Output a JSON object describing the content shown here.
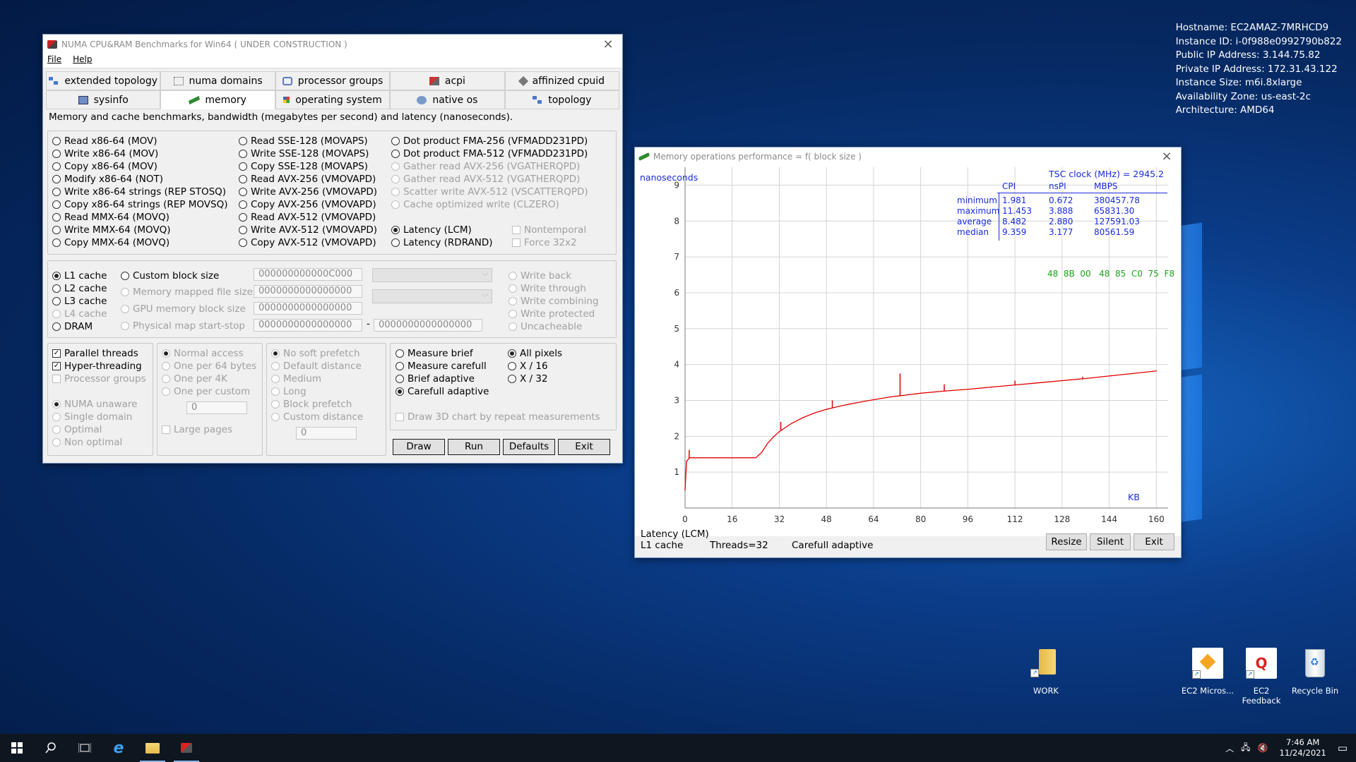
{
  "sysinfo": {
    "lines": [
      "Hostname: EC2AMAZ-7MRHCD9",
      "Instance ID: i-0f988e0992790b822",
      "Public IP Address: 3.144.75.82",
      "Private IP Address: 172.31.43.122",
      "Instance Size: m6i.8xlarge",
      "Availability Zone: us-east-2c",
      "Architecture: AMD64"
    ]
  },
  "main": {
    "title": "NUMA CPU&RAM Benchmarks for Win64 ( UNDER CONSTRUCTION )",
    "menu": [
      "File",
      "Help"
    ],
    "tabs_row1": [
      {
        "label": "extended topology",
        "icon": "topology-icon"
      },
      {
        "label": "numa domains",
        "icon": "numa-icon"
      },
      {
        "label": "processor groups",
        "icon": "groups-icon"
      },
      {
        "label": "acpi",
        "icon": "acpi-icon"
      },
      {
        "label": "affinized cpuid",
        "icon": "cpuid-icon"
      }
    ],
    "tabs_row2": [
      {
        "label": "sysinfo",
        "icon": "sysinfo-icon"
      },
      {
        "label": "memory",
        "icon": "memory-icon",
        "active": true
      },
      {
        "label": "operating system",
        "icon": "os-icon"
      },
      {
        "label": "native os",
        "icon": "native-icon"
      },
      {
        "label": "topology",
        "icon": "topology-icon"
      }
    ],
    "description": "Memory and cache benchmarks, bandwidth (megabytes per second) and latency (nanoseconds).",
    "ops_col1": [
      "Read x86-64 (MOV)",
      "Write x86-64 (MOV)",
      "Copy x86-64 (MOV)",
      "Modify x86-64 (NOT)",
      "Write x86-64 strings (REP STOSQ)",
      "Copy x86-64 strings (REP MOVSQ)",
      "Read MMX-64 (MOVQ)",
      "Write MMX-64 (MOVQ)",
      "Copy MMX-64 (MOVQ)"
    ],
    "ops_col2": [
      "Read SSE-128 (MOVAPS)",
      "Write SSE-128 (MOVAPS)",
      "Copy SSE-128 (MOVAPS)",
      "Read AVX-256 (VMOVAPD)",
      "Write AVX-256 (VMOVAPD)",
      "Copy AVX-256 (VMOVAPD)",
      "Read AVX-512 (VMOVAPD)",
      "Write AVX-512 (VMOVAPD)",
      "Copy AVX-512 (VMOVAPD)"
    ],
    "ops_col3": [
      "Dot product FMA-256 (VFMADD231PD)",
      "Dot product FMA-512 (VFMADD231PD)",
      "Gather read AVX-256 (VGATHERQPD)",
      "Gather read AVX-512 (VGATHERQPD)",
      "Scatter write AVX-512 (VSCATTERQPD)",
      "Cache optimized write (CLZERO)"
    ],
    "latency_lcm": "Latency (LCM)",
    "latency_rdrand": "Latency (RDRAND)",
    "nontemporal": "Nontemporal",
    "force32": "Force 32x2",
    "cache": [
      "L1 cache",
      "L2 cache",
      "L3 cache",
      "L4 cache",
      "DRAM"
    ],
    "custom_block": "Custom block size",
    "mmf": "Memory mapped file size",
    "gpu": "GPU memory block size",
    "phys": "Physical map start-stop",
    "tb_custom": "000000000000C000",
    "tb_mmf": "0000000000000000",
    "tb_gpu": "0000000000000000",
    "tb_phys1": "0000000000000000",
    "tb_phys2": "0000000000000000",
    "dash": "-",
    "write_modes": [
      "Write back",
      "Write through",
      "Write combining",
      "Write protected",
      "Uncacheable"
    ],
    "parallel": "Parallel threads",
    "ht": "Hyper-threading",
    "pg": "Processor groups",
    "numa": [
      "NUMA unaware",
      "Single domain",
      "Optimal",
      "Non optimal"
    ],
    "access": [
      "Normal access",
      "One per 64 bytes",
      "One per 4K",
      "One per custom"
    ],
    "access_val": "0",
    "large_pages": "Large pages",
    "prefetch": [
      "No soft prefetch",
      "Default distance",
      "Medium",
      "Long",
      "Block prefetch",
      "Custom distance"
    ],
    "prefetch_val": "0",
    "measure": [
      "Measure brief",
      "Measure carefull",
      "Brief adaptive",
      "Carefull adaptive"
    ],
    "pixels": [
      "All pixels",
      "X / 16",
      "X / 32"
    ],
    "draw3d": "Draw 3D chart by repeat measurements",
    "buttons": {
      "draw": "Draw",
      "run": "Run",
      "defaults": "Defaults",
      "exit": "Exit"
    }
  },
  "chartwin": {
    "title": "Memory operations performance = f( block size )",
    "status1": "Latency (LCM)",
    "status2": "L1 cache",
    "status3": "Threads=32",
    "status4": "Carefull adaptive",
    "buttons": {
      "resize": "Resize",
      "silent": "Silent",
      "exit": "Exit"
    },
    "tsc": "TSC clock (MHz)  = 2945.2",
    "stats_rows": [
      "minimum",
      "maximum",
      "average",
      "median"
    ],
    "cols": {
      "cpi": "CPI",
      "nspi": "nsPI",
      "mbps": "MBPS"
    },
    "cpi": [
      "1.981",
      "11.453",
      "8.482",
      "9.359"
    ],
    "nspi": [
      "0.672",
      "3.888",
      "2.880",
      "3.177"
    ],
    "mbps": [
      "380457.78",
      "65831.30",
      "127591.03",
      "80561.59"
    ],
    "opcode": "48  8B  00   48  85  C0  75  F8",
    "colors": {
      "line": "#e00000",
      "text_stats": "#1a2ae0",
      "opcode": "#1da01d"
    }
  },
  "chart_data": {
    "type": "line",
    "ylabel": "nanoseconds",
    "xlabel": "KB",
    "xlim": [
      0,
      164
    ],
    "ylim": [
      0,
      9.5
    ],
    "xticks": [
      0,
      16,
      32,
      48,
      64,
      80,
      96,
      112,
      128,
      144,
      160
    ],
    "yticks": [
      1,
      2,
      3,
      4,
      5,
      6,
      7,
      8,
      9
    ],
    "series": [
      {
        "x": [
          0,
          0.5,
          1.5,
          5,
          10,
          16,
          20,
          24,
          26,
          28,
          30,
          32,
          36,
          40,
          44,
          48,
          52,
          56,
          60,
          64,
          70,
          76,
          80,
          88,
          96,
          104,
          112,
          120,
          128,
          136,
          144,
          152,
          160
        ],
        "y": [
          0.5,
          1.3,
          1.4,
          1.4,
          1.4,
          1.4,
          1.4,
          1.4,
          1.55,
          1.8,
          1.98,
          2.13,
          2.35,
          2.52,
          2.65,
          2.75,
          2.83,
          2.9,
          2.96,
          3.02,
          3.1,
          3.16,
          3.2,
          3.26,
          3.31,
          3.37,
          3.43,
          3.49,
          3.55,
          3.61,
          3.68,
          3.75,
          3.82
        ]
      }
    ],
    "spikes": [
      {
        "x": 1.4,
        "y": 1.62
      },
      {
        "x": 32.5,
        "y": 2.4
      },
      {
        "x": 50,
        "y": 3.0
      },
      {
        "x": 73,
        "y": 3.75
      },
      {
        "x": 88,
        "y": 3.45
      },
      {
        "x": 112,
        "y": 3.55
      },
      {
        "x": 135,
        "y": 3.66
      }
    ],
    "grid": true
  },
  "desktop": {
    "icons": [
      {
        "label": "WORK"
      },
      {
        "label": "EC2 Micros..."
      },
      {
        "label": "EC2 Feedback"
      },
      {
        "label": "Recycle Bin"
      }
    ]
  },
  "taskbar": {
    "time": "7:46 AM",
    "date": "11/24/2021"
  }
}
